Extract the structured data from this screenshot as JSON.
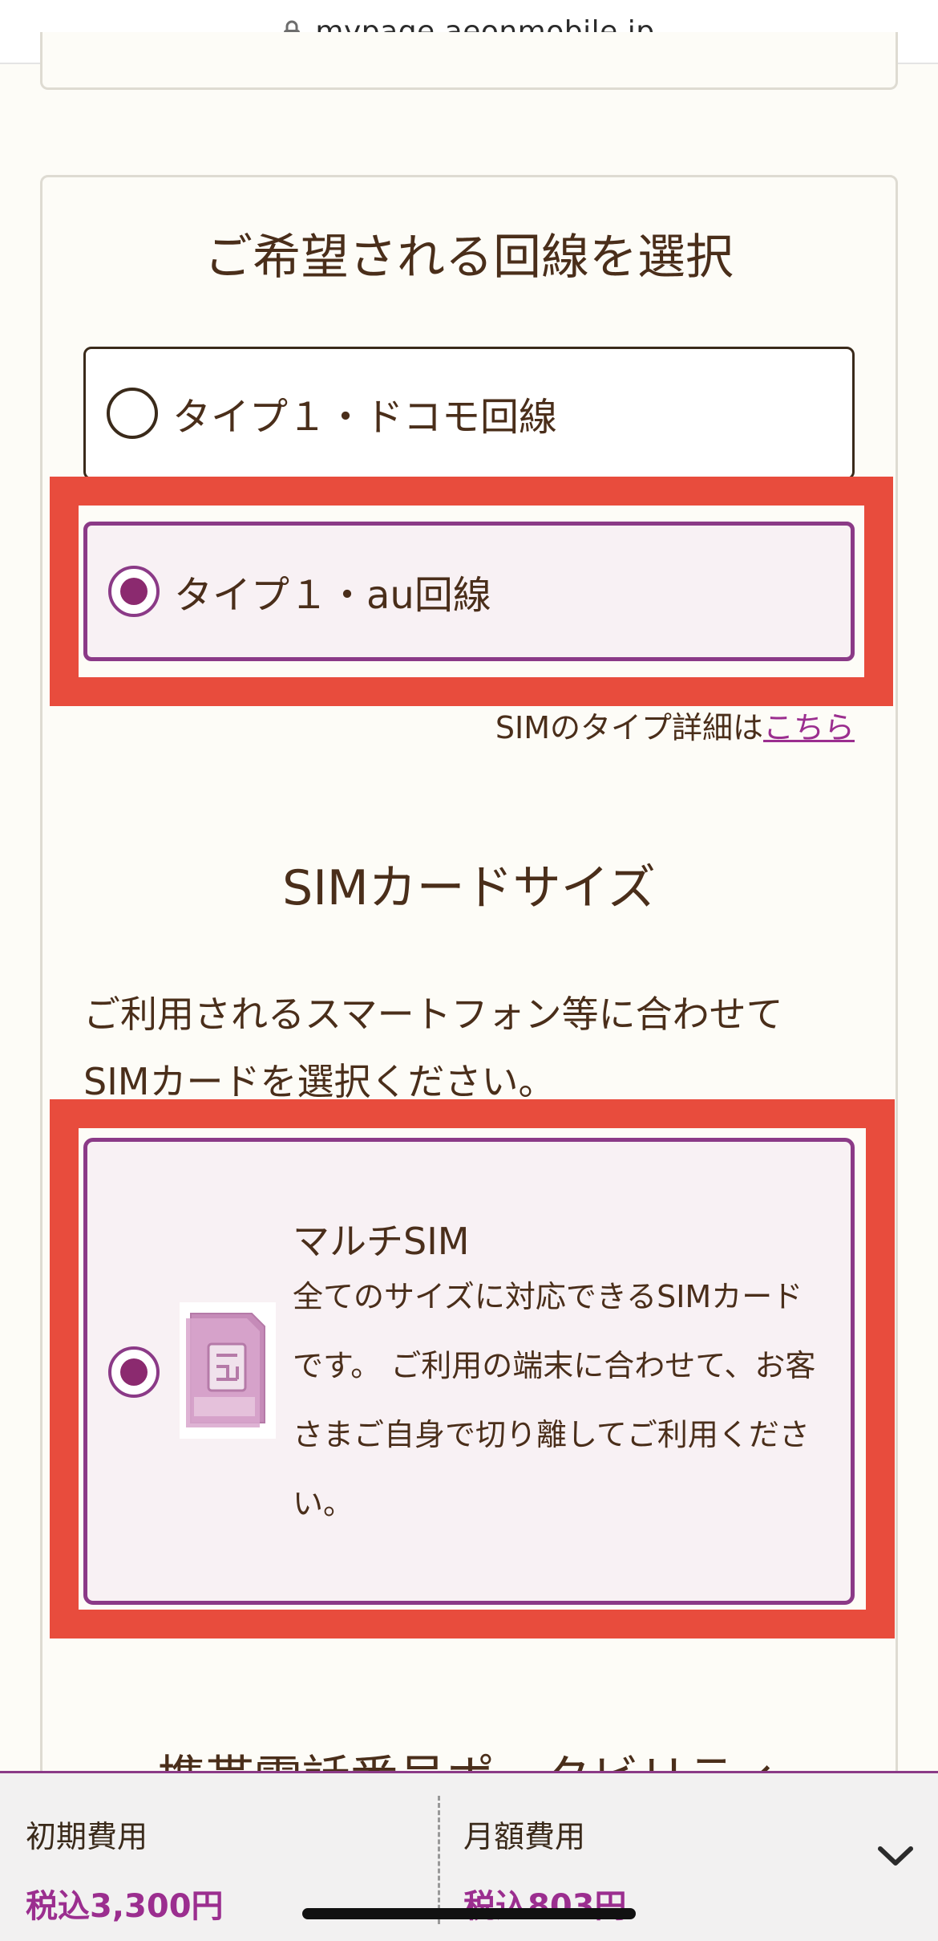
{
  "browser": {
    "url": "mypage.aeonmobile.jp"
  },
  "line_section": {
    "title": "ご希望される回線を選択",
    "options": [
      {
        "label": "タイプ１・ドコモ回線",
        "selected": false
      },
      {
        "label": "タイプ１・au回線",
        "selected": true
      }
    ],
    "detail_prefix": "SIMのタイプ詳細は",
    "detail_link": "こちら"
  },
  "sim_section": {
    "title": "SIMカードサイズ",
    "description_line1": "ご利用されるスマートフォン等に合わせて",
    "description_line2": "SIMカードを選択ください。",
    "option": {
      "title": "マルチSIM",
      "text_line1": "全てのサイズに対応できるSIMカード",
      "text_line2": "です。 ご利用の端末に合わせて、お客",
      "text_line3": "さまご自身で切り離してご利用くださ",
      "text_line4": "い。",
      "selected": true,
      "icon": "sim-card-icon"
    }
  },
  "next_section": {
    "title_partial": "携帯電話番号ポータビリティ"
  },
  "bottom_bar": {
    "initial_label": "初期費用",
    "initial_value": "税込3,300円",
    "monthly_label": "月額費用",
    "monthly_value": "税込803円",
    "toggle_icon": "chevron-down-icon"
  },
  "colors": {
    "accent": "#8b3a87",
    "highlight": "#e84c3d",
    "price": "#9b2e8f",
    "text": "#4a2e1a"
  }
}
